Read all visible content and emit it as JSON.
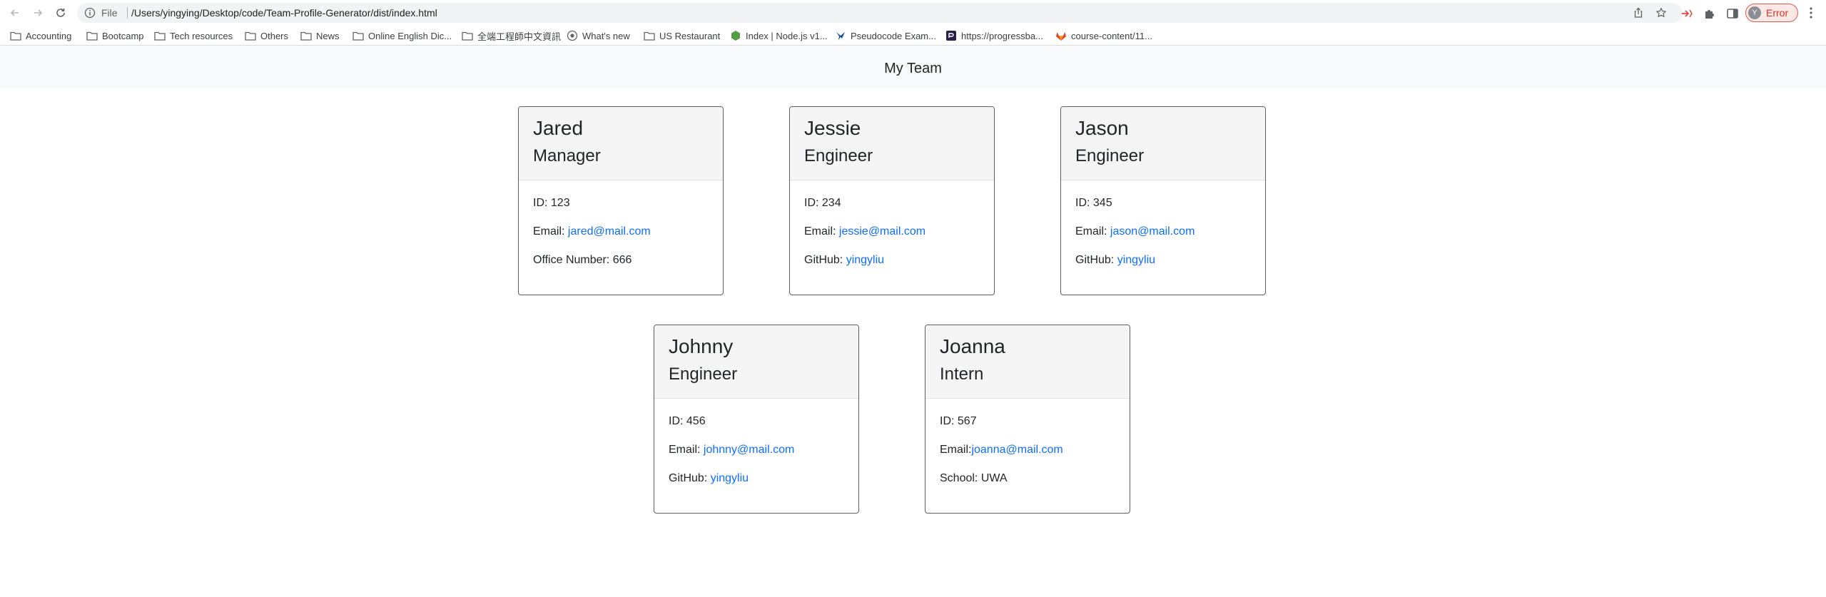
{
  "browser": {
    "url_scheme": "File",
    "url": "/Users/yingying/Desktop/code/Team-Profile-Generator/dist/index.html",
    "profile_initial": "Y",
    "profile_status": "Error",
    "bookmarks": [
      {
        "label": "Accounting",
        "icon": "folder-icon"
      },
      {
        "label": "Bootcamp",
        "icon": "folder-icon"
      },
      {
        "label": "Tech resources",
        "icon": "folder-icon"
      },
      {
        "label": "Others",
        "icon": "folder-icon"
      },
      {
        "label": "News",
        "icon": "folder-icon"
      },
      {
        "label": "Online English Dic...",
        "icon": "folder-icon"
      },
      {
        "label": "全端工程師中文資訊",
        "icon": "folder-icon"
      },
      {
        "label": "What's new",
        "icon": "chrome-icon"
      },
      {
        "label": "US Restaurant",
        "icon": "folder-icon"
      },
      {
        "label": "Index | Node.js v1...",
        "icon": "nodejs-icon"
      },
      {
        "label": "Pseudocode Exam...",
        "icon": "bird-icon"
      },
      {
        "label": "https://progressba...",
        "icon": "progressbar-icon"
      },
      {
        "label": "course-content/11...",
        "icon": "gitlab-icon"
      }
    ]
  },
  "page": {
    "title": "My Team",
    "cards": [
      {
        "name": "Jared",
        "role": "Manager",
        "id_line": "ID: 123",
        "email_prefix": "Email: ",
        "email": "jared@mail.com",
        "extra_prefix": "Office Number: 666",
        "extra_link": ""
      },
      {
        "name": "Jessie",
        "role": "Engineer",
        "id_line": "ID: 234",
        "email_prefix": "Email: ",
        "email": "jessie@mail.com",
        "extra_prefix": "GitHub: ",
        "extra_link": "yingyliu"
      },
      {
        "name": "Jason",
        "role": "Engineer",
        "id_line": "ID: 345",
        "email_prefix": "Email: ",
        "email": "jason@mail.com",
        "extra_prefix": "GitHub: ",
        "extra_link": "yingyliu"
      },
      {
        "name": "Johnny",
        "role": "Engineer",
        "id_line": "ID: 456",
        "email_prefix": "Email: ",
        "email": "johnny@mail.com",
        "extra_prefix": "GitHub: ",
        "extra_link": "yingyliu"
      },
      {
        "name": "Joanna",
        "role": "Intern",
        "id_line": "ID: 567",
        "email_prefix": "Email:",
        "email": "joanna@mail.com",
        "extra_prefix": "School: UWA",
        "extra_link": ""
      }
    ]
  }
}
